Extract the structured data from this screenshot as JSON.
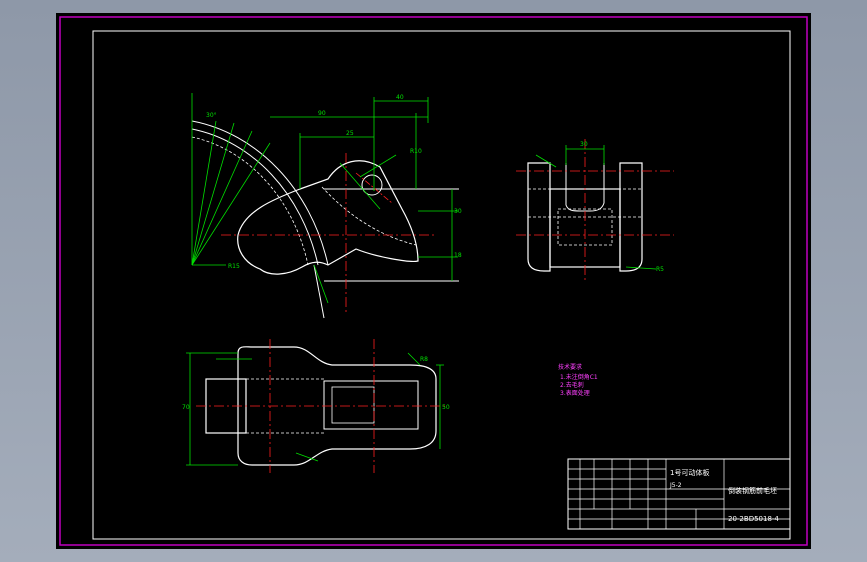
{
  "colors": {
    "background": "#000000",
    "frame": "#c000c0",
    "border": "#ffffff",
    "outline": "#ffffff",
    "centerline": "#ff2020",
    "dimension": "#00e000",
    "hidden": "#ffffff",
    "notes": "#ff40ff"
  },
  "title_block": {
    "part_name": "1号可动体板",
    "material": "J5-2",
    "drawing_title": "倒装钢筋前毛坯",
    "drawing_number": "20-2BD5018-4"
  },
  "tech_notes": {
    "heading": "技术要求",
    "lines": [
      "1.未注倒角C1",
      "2.去毛刺",
      "3.表面处理"
    ]
  }
}
